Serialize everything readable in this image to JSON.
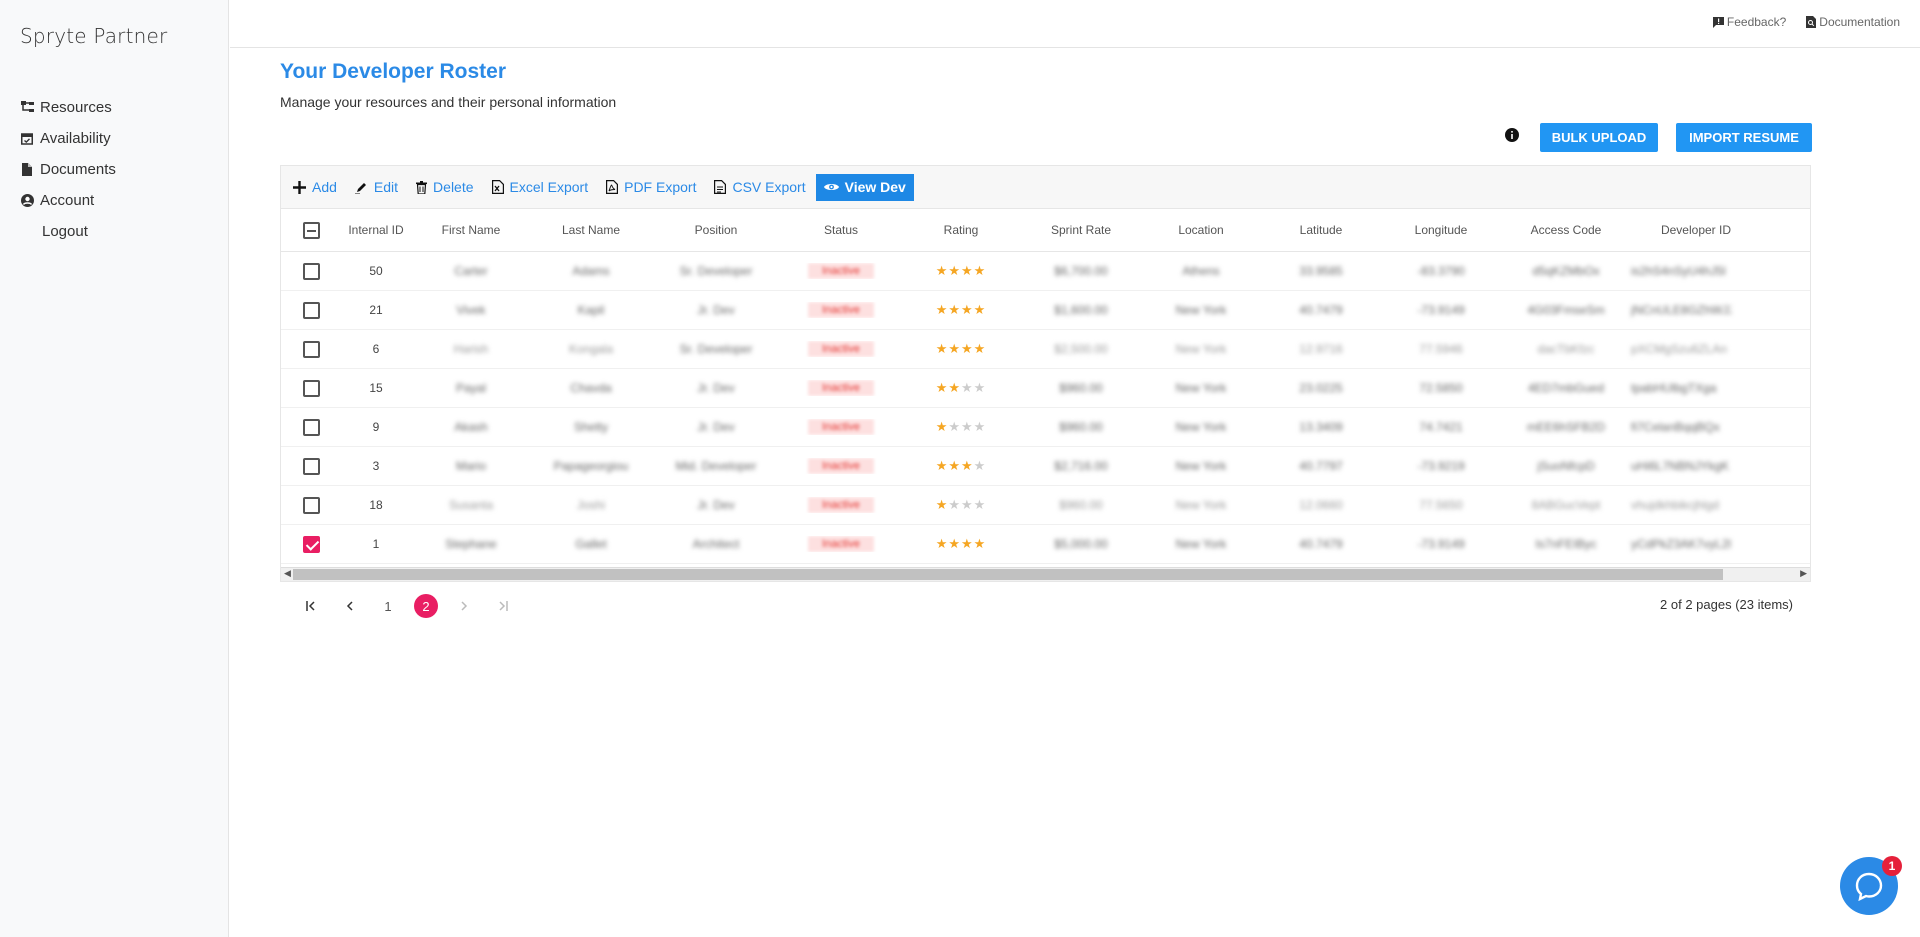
{
  "app": {
    "title": "Spryte Partner"
  },
  "sidebar": {
    "items": [
      {
        "label": "Resources",
        "icon": "sitemap-icon"
      },
      {
        "label": "Availability",
        "icon": "calendar-check-icon"
      },
      {
        "label": "Documents",
        "icon": "file-icon"
      },
      {
        "label": "Account",
        "icon": "user-circle-icon"
      },
      {
        "label": "Logout"
      }
    ]
  },
  "topbar": {
    "feedback": "Feedback?",
    "documentation": "Documentation"
  },
  "page": {
    "title": "Your Developer Roster",
    "subtitle": "Manage your resources and their personal information"
  },
  "actions": {
    "bulk_upload": "BULK UPLOAD",
    "import_resume": "IMPORT RESUME"
  },
  "toolbar": {
    "add": "Add",
    "edit": "Edit",
    "delete": "Delete",
    "excel": "Excel Export",
    "pdf": "PDF Export",
    "csv": "CSV Export",
    "view_dev": "View Dev"
  },
  "table": {
    "columns": [
      "Internal ID",
      "First Name",
      "Last Name",
      "Position",
      "Status",
      "Rating",
      "Sprint Rate",
      "Location",
      "Latitude",
      "Longitude",
      "Access Code",
      "Developer ID"
    ],
    "rows": [
      {
        "id": "50",
        "first": "Carter",
        "last": "Adams",
        "position": "Sr. Developer",
        "status": "Inactive",
        "rating": 4,
        "rate": "$6,700.00",
        "location": "Athens",
        "lat": "33.9585",
        "lng": "-83.3790",
        "code": "d5qKZMbOx",
        "devid": "is2hS4nSyU4hJ5l",
        "checked": false
      },
      {
        "id": "21",
        "first": "Vivek",
        "last": "Kapil",
        "position": "Jr. Dev",
        "status": "Inactive",
        "rating": 4,
        "rate": "$1,600.00",
        "location": "New York",
        "lat": "40.7479",
        "lng": "-73.9149",
        "code": "4G03FmseSm",
        "devid": "jNCnULE8GZhWJ2",
        "checked": false
      },
      {
        "id": "6",
        "first": "Harish",
        "last": "Kongala",
        "position": "Sr. Developer",
        "status": "Inactive",
        "rating": 4,
        "rate": "$2,500.00",
        "location": "New York",
        "lat": "12.9716",
        "lng": "77.5946",
        "code": "dacTbKfzc",
        "devid": "pXCMgSzu6ZLAn",
        "checked": false
      },
      {
        "id": "15",
        "first": "Payal",
        "last": "Chavda",
        "position": "Jr. Dev",
        "status": "Inactive",
        "rating": 2,
        "rate": "$960.00",
        "location": "New York",
        "lat": "23.0225",
        "lng": "72.5850",
        "code": "4ED7mbGued",
        "devid": "tpabHUlbgTXga",
        "checked": false
      },
      {
        "id": "9",
        "first": "Akash",
        "last": "Shetty",
        "position": "Jr. Dev",
        "status": "Inactive",
        "rating": 1,
        "rate": "$960.00",
        "location": "New York",
        "lat": "13.3409",
        "lng": "74.7421",
        "code": "mEE6hSFB2D",
        "devid": "fi7CelanBqqBQx",
        "checked": false
      },
      {
        "id": "3",
        "first": "Mario",
        "last": "Papageorgiou",
        "position": "Mid. Developer",
        "status": "Inactive",
        "rating": 3,
        "rate": "$2,716.00",
        "location": "New York",
        "lat": "40.7797",
        "lng": "-73.9219",
        "code": "jSuoNfcpD",
        "devid": "uHi6L7NBNJYkgK",
        "checked": false
      },
      {
        "id": "18",
        "first": "Susanta",
        "last": "Joshi",
        "position": "Jr. Dev",
        "status": "Inactive",
        "rating": 1,
        "rate": "$960.00",
        "location": "New York",
        "lat": "12.0660",
        "lng": "77.5650",
        "code": "8ABGucVept",
        "devid": "vhujdkhbikcjhlgd",
        "checked": false
      },
      {
        "id": "1",
        "first": "Stephane",
        "last": "Gallet",
        "position": "Architect",
        "status": "Inactive",
        "rating": 4,
        "rate": "$5,000.00",
        "location": "New York",
        "lat": "40.7479",
        "lng": "-73.9149",
        "code": "Is7nFEIByc",
        "devid": "yCdPkZ3AK7vyL2l",
        "checked": true
      }
    ]
  },
  "pagination": {
    "pages": [
      "1",
      "2"
    ],
    "current": "2",
    "info": "2 of 2 pages (23 items)"
  },
  "chat": {
    "badge": "1"
  },
  "colors": {
    "accent": "#2b8ae6",
    "primary_button": "#2196f3",
    "selected": "#e91e63",
    "star": "#f5a623"
  }
}
